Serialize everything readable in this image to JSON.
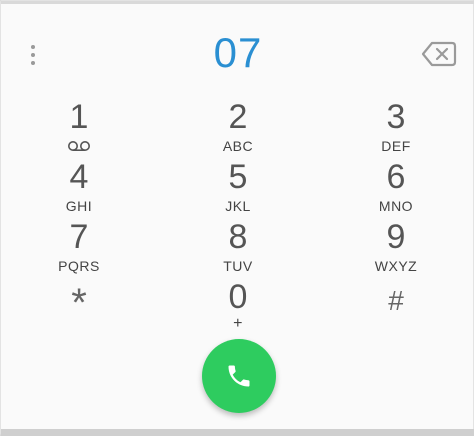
{
  "dialer": {
    "number": "07",
    "accent_color": "#2a8fd2",
    "call_color": "#2ecc5f"
  },
  "keys": [
    {
      "digit": "1",
      "letters": "",
      "icon": "voicemail-icon"
    },
    {
      "digit": "2",
      "letters": "ABC"
    },
    {
      "digit": "3",
      "letters": "DEF"
    },
    {
      "digit": "4",
      "letters": "GHI"
    },
    {
      "digit": "5",
      "letters": "JKL"
    },
    {
      "digit": "6",
      "letters": "MNO"
    },
    {
      "digit": "7",
      "letters": "PQRS"
    },
    {
      "digit": "8",
      "letters": "TUV"
    },
    {
      "digit": "9",
      "letters": "WXYZ"
    },
    {
      "digit": "*",
      "letters": ""
    },
    {
      "digit": "0",
      "letters": "+"
    },
    {
      "digit": "#",
      "letters": ""
    }
  ],
  "icons": {
    "overflow": "more-vert-icon",
    "backspace": "backspace-icon",
    "call": "phone-icon"
  }
}
